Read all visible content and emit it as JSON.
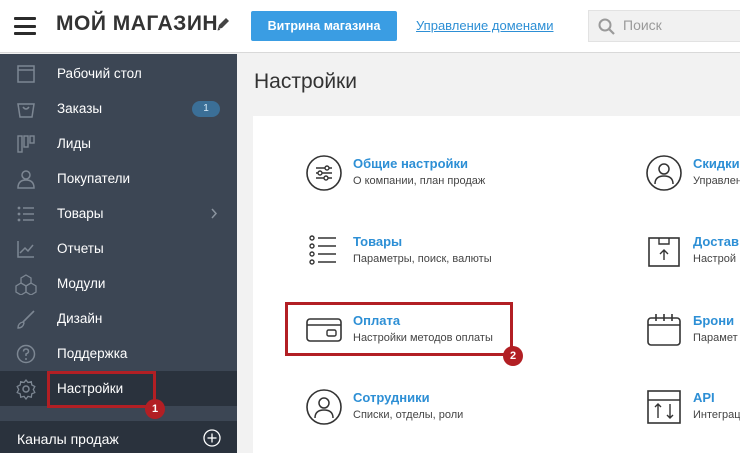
{
  "header": {
    "store_title": "МОЙ МАГАЗИН",
    "storefront_button": "Витрина магазина",
    "domains_link": "Управление доменами",
    "search_placeholder": "Поиск"
  },
  "sidebar": {
    "items": [
      {
        "label": "Рабочий стол",
        "icon": "dashboard-icon"
      },
      {
        "label": "Заказы",
        "icon": "orders-icon",
        "badge": "1"
      },
      {
        "label": "Лиды",
        "icon": "leads-icon"
      },
      {
        "label": "Покупатели",
        "icon": "customers-icon"
      },
      {
        "label": "Товары",
        "icon": "products-icon"
      },
      {
        "label": "Отчеты",
        "icon": "reports-icon"
      },
      {
        "label": "Модули",
        "icon": "modules-icon"
      },
      {
        "label": "Дизайн",
        "icon": "design-icon"
      },
      {
        "label": "Поддержка",
        "icon": "support-icon"
      },
      {
        "label": "Настройки",
        "icon": "settings-gear-icon",
        "active": true
      }
    ],
    "sales_channels": "Каналы продаж"
  },
  "main": {
    "page_title": "Настройки",
    "settings": [
      {
        "title": "Общие настройки",
        "desc": "О компании, план продаж"
      },
      {
        "title": "Товары",
        "desc": "Параметры, поиск, валюты"
      },
      {
        "title": "Оплата",
        "desc": "Настройки методов оплаты"
      },
      {
        "title": "Сотрудники",
        "desc": "Списки, отделы, роли"
      },
      {
        "title": "Скидки",
        "desc": "Управлен"
      },
      {
        "title": "Достав",
        "desc": "Настрой"
      },
      {
        "title": "Брони",
        "desc": "Парамет"
      },
      {
        "title": "API",
        "desc": "Интеграц"
      }
    ]
  },
  "annotations": {
    "step1": "1",
    "step2": "2"
  },
  "colors": {
    "accent": "#3a9de3",
    "link": "#2d8fd5",
    "sidebar_bg": "#3c4654",
    "highlight": "#b21f24"
  }
}
